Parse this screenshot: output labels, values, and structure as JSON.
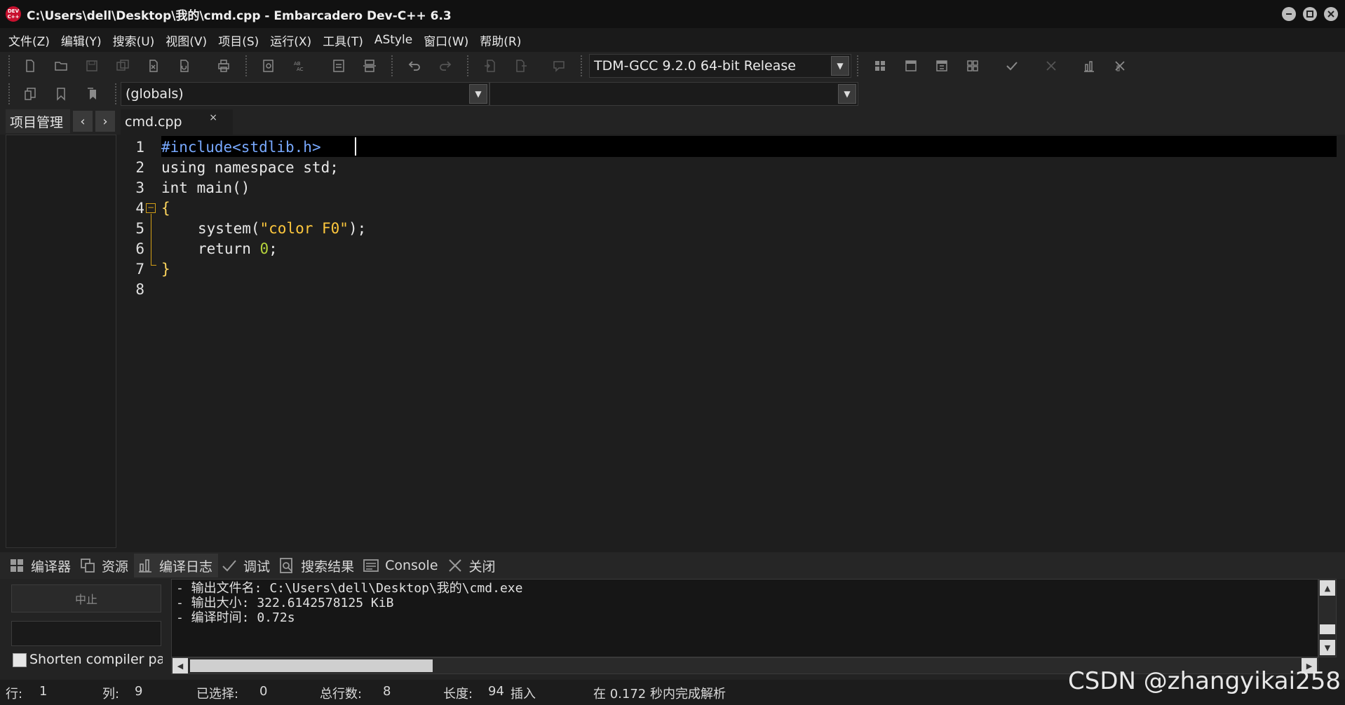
{
  "window": {
    "logo_text": "DEV C++",
    "title": "C:\\Users\\dell\\Desktop\\我的\\cmd.cpp - Embarcadero Dev-C++ 6.3"
  },
  "menu": [
    "文件(Z)",
    "编辑(Y)",
    "搜索(U)",
    "视图(V)",
    "项目(S)",
    "运行(X)",
    "工具(T)",
    "AStyle",
    "窗口(W)",
    "帮助(R)"
  ],
  "toolbar": {
    "compiler_select": "TDM-GCC 9.2.0 64-bit Release",
    "scope_select": "(globals)",
    "function_select": ""
  },
  "tabs": {
    "project_manager": "项目管理",
    "file_tab": "cmd.cpp",
    "close_glyph": "×"
  },
  "editor": {
    "line_numbers": [
      "1",
      "2",
      "3",
      "4",
      "5",
      "6",
      "7",
      "8"
    ],
    "code": {
      "l1_pre": "#include",
      "l1_rest": "<stdlib.h>",
      "l2": "using namespace std;",
      "l3": "int main()",
      "l4": "{",
      "l5_fn": "system(",
      "l5_str": "\"color F0\"",
      "l5_end": ");",
      "l6_kw": "return ",
      "l6_num": "0",
      "l6_end": ";",
      "l7": "}"
    }
  },
  "bottom_tabs": [
    {
      "label": "编译器",
      "icon": "grid-icon"
    },
    {
      "label": "资源",
      "icon": "resources-icon"
    },
    {
      "label": "编译日志",
      "icon": "bar-chart-icon"
    },
    {
      "label": "调试",
      "icon": "check-icon"
    },
    {
      "label": "搜索结果",
      "icon": "search-doc-icon"
    },
    {
      "label": "Console",
      "icon": "console-icon"
    },
    {
      "label": "关闭",
      "icon": "close-icon"
    }
  ],
  "compile_panel": {
    "stop_label": "中止",
    "shorten_label": "Shorten compiler paths",
    "log": [
      "- 输出文件名: C:\\Users\\dell\\Desktop\\我的\\cmd.exe",
      "- 输出大小: 322.6142578125 KiB",
      "- 编译时间: 0.72s"
    ]
  },
  "status": {
    "row_label": "行:",
    "row_value": "1",
    "col_label": "列:",
    "col_value": "9",
    "sel_label": "已选择:",
    "sel_value": "0",
    "total_label": "总行数:",
    "total_value": "8",
    "len_label": "长度:",
    "len_value": "94",
    "mode": "插入",
    "parse_msg": "在 0.172 秒内完成解析"
  },
  "watermark": "CSDN @zhangyikai258",
  "colors": {
    "background": "#1e1e1e",
    "preprocessor": "#78a9ff",
    "string": "#ffc83d",
    "number": "#b5d33b",
    "fold_marker": "#d4a017"
  }
}
